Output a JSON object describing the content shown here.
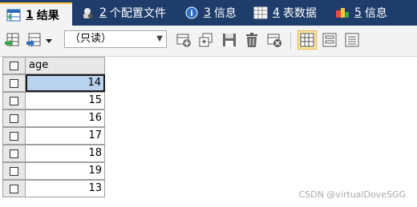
{
  "tabs": [
    {
      "num": "1",
      "label": "结果",
      "icon": "table-icon"
    },
    {
      "num": "2",
      "label": "个配置文件",
      "icon": "profile-icon"
    },
    {
      "num": "3",
      "label": "信息",
      "icon": "info-icon"
    },
    {
      "num": "4",
      "label": "表数据",
      "icon": "table-data-icon"
    },
    {
      "num": "5",
      "label": "信息",
      "icon": "info-history-icon"
    }
  ],
  "toolbar": {
    "mode_select": "（只读）",
    "icons": [
      "export-icon",
      "export-dropdown-icon",
      "add-row-icon",
      "duplicate-row-icon",
      "save-icon",
      "delete-icon",
      "cancel-icon",
      "grid-view-icon",
      "form-view-icon",
      "text-view-icon"
    ]
  },
  "grid": {
    "column": "age",
    "rows": [
      "14",
      "15",
      "16",
      "17",
      "18",
      "19",
      "13"
    ],
    "selected_row": 0
  },
  "watermark": "CSDN @virtualDoveSGG",
  "colors": {
    "tabbar_bg": "#1e3d6b",
    "selected_cell": "#b9d3ee",
    "active_tab_accent": "#f5c542"
  }
}
